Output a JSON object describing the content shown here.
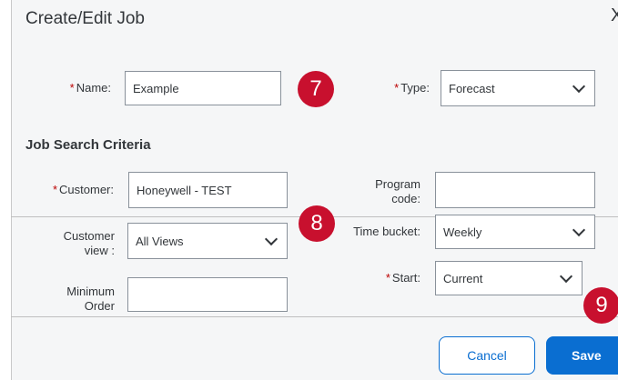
{
  "dialog": {
    "title": "Create/Edit Job",
    "close_glyph": "X"
  },
  "form": {
    "required_marker": "*",
    "name": {
      "label": "Name:",
      "value": "Example"
    },
    "type": {
      "label": "Type:",
      "value": "Forecast"
    },
    "section_title": "Job Search Criteria",
    "customer": {
      "label": "Customer:",
      "value": "Honeywell - TEST"
    },
    "program_code": {
      "label_line1": "Program",
      "label_line2": "code:",
      "value": ""
    },
    "customer_view": {
      "label_line1": "Customer",
      "label_line2": "view :",
      "value": "All Views"
    },
    "time_bucket": {
      "label": "Time bucket:",
      "value": "Weekly"
    },
    "start": {
      "label": "Start:",
      "value": "Current"
    },
    "minimum_order": {
      "label_line1": "Minimum",
      "label_line2": "Order",
      "value": ""
    }
  },
  "badges": {
    "step7": "7",
    "step8": "8",
    "step9": "9"
  },
  "footer": {
    "cancel_label": "Cancel",
    "save_label": "Save"
  },
  "colors": {
    "accent": "#0a6ed1",
    "badge": "#c8102e",
    "required": "#bb0000",
    "dialog_bg": "#f5f6f7"
  }
}
